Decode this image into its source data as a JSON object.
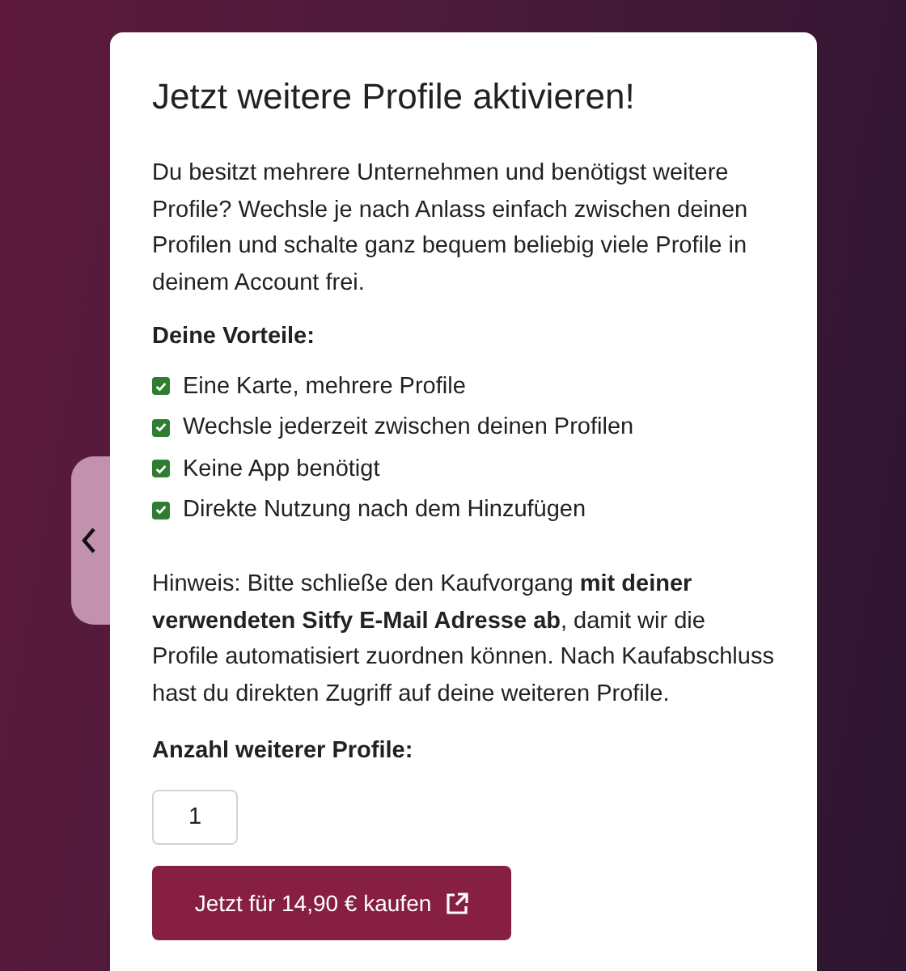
{
  "title": "Jetzt weitere Profile aktivieren!",
  "intro": "Du besitzt mehrere Unternehmen und benötigst weitere Profile? Wechsle je nach Anlass einfach zwischen deinen Profilen und schalte ganz bequem beliebig viele Profile in deinem Account frei.",
  "benefits_heading": "Deine Vorteile:",
  "benefits": [
    {
      "label": "Eine Karte, mehrere Profile",
      "checked": true
    },
    {
      "label": "Wechsle jederzeit zwischen deinen Profilen",
      "checked": true
    },
    {
      "label": "Keine App benötigt",
      "checked": true
    },
    {
      "label": "Direkte Nutzung nach dem Hinzufügen",
      "checked": true
    }
  ],
  "note": "Hinweis: Bitte schließe den Kaufvorgang **mit deiner verwendeten Sitfy E-Mail Adresse ab**, damit wir die Profile automatisiert zuordnen können. Nach Kaufabschluss hast du direkten Zugriff auf deine weiteren Profile.",
  "quantity_label": "Anzahl weiterer Profile:",
  "quantity": "1",
  "buy_button": "Jetzt für 14,90 € kaufen"
}
